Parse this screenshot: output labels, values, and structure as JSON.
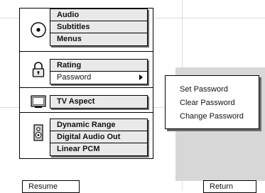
{
  "menu": {
    "groups": [
      {
        "icon": "disc-icon",
        "items": [
          "Audio",
          "Subtitles",
          "Menus"
        ]
      },
      {
        "icon": "lock-icon",
        "items": [
          "Rating",
          "Password"
        ]
      },
      {
        "icon": "tv-icon",
        "items": [
          "TV Aspect"
        ]
      },
      {
        "icon": "speaker-icon",
        "items": [
          "Dynamic Range",
          "Digital Audio Out",
          "Linear PCM"
        ]
      }
    ],
    "selected_item": "Password"
  },
  "submenu": {
    "items": [
      "Set Password",
      "Clear Password",
      "Change Password"
    ]
  },
  "footer": {
    "resume_label": "Resume",
    "return_label": "Return"
  }
}
